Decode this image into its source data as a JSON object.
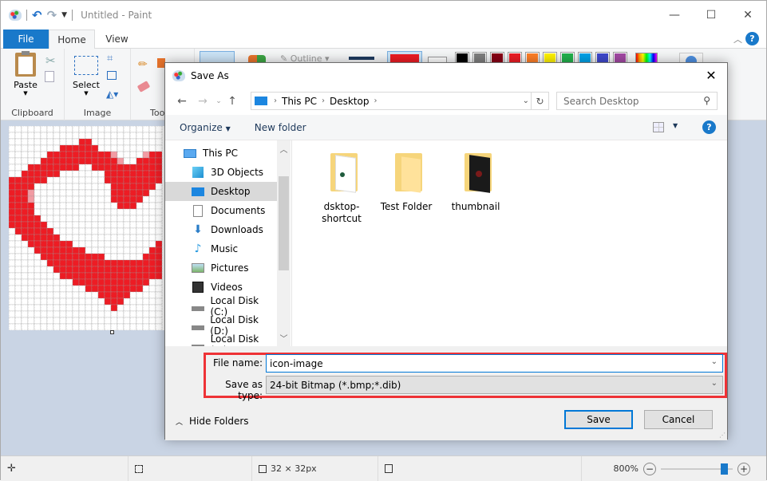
{
  "app": {
    "title": "Untitled - Paint",
    "tabs": [
      {
        "label": "File"
      },
      {
        "label": "Home"
      },
      {
        "label": "View"
      }
    ],
    "ribbon": {
      "groups": [
        {
          "label": "Clipboard"
        },
        {
          "label": "Image"
        },
        {
          "label": "Tools"
        }
      ],
      "paste_label": "Paste",
      "select_label": "Select",
      "outline_label": "Outline",
      "palette": [
        "#000000",
        "#7f7f7f",
        "#880015",
        "#ed1c24",
        "#ff7f27",
        "#fff200",
        "#22b14c",
        "#00a2e8",
        "#3f48cc",
        "#a349a4"
      ],
      "color1": "#ed1c24",
      "color2": "#ffffff"
    },
    "statusbar": {
      "dimensions": "32 × 32px",
      "zoom": "800%",
      "zoom_level_fraction": 0.92
    }
  },
  "dialog": {
    "title": "Save As",
    "breadcrumb": [
      {
        "label": "This PC"
      },
      {
        "label": "Desktop"
      }
    ],
    "search_placeholder": "Search Desktop",
    "commands": {
      "organize": "Organize",
      "new_folder": "New folder"
    },
    "nav_items": [
      {
        "label": "This PC",
        "icon": "this-pc-icon"
      },
      {
        "label": "3D Objects",
        "icon": "3d-objects-icon"
      },
      {
        "label": "Desktop",
        "icon": "desktop-icon",
        "selected": true
      },
      {
        "label": "Documents",
        "icon": "documents-icon"
      },
      {
        "label": "Downloads",
        "icon": "downloads-icon"
      },
      {
        "label": "Music",
        "icon": "music-icon"
      },
      {
        "label": "Pictures",
        "icon": "pictures-icon"
      },
      {
        "label": "Videos",
        "icon": "videos-icon"
      },
      {
        "label": "Local Disk (C:)",
        "icon": "drive-c-icon"
      },
      {
        "label": "Local Disk (D:)",
        "icon": "drive-d-icon"
      },
      {
        "label": "Local Disk (E:)",
        "icon": "drive-e-icon"
      }
    ],
    "files": [
      {
        "label": "dsktop-shortcut"
      },
      {
        "label": "Test Folder"
      },
      {
        "label": "thumbnail"
      }
    ],
    "file_name_label": "File name:",
    "file_name_value": "icon-image",
    "save_type_label": "Save as type:",
    "save_type_value": "24-bit Bitmap (*.bmp;*.dib)",
    "hide_folders": "Hide Folders",
    "save_button": "Save",
    "cancel_button": "Cancel"
  }
}
